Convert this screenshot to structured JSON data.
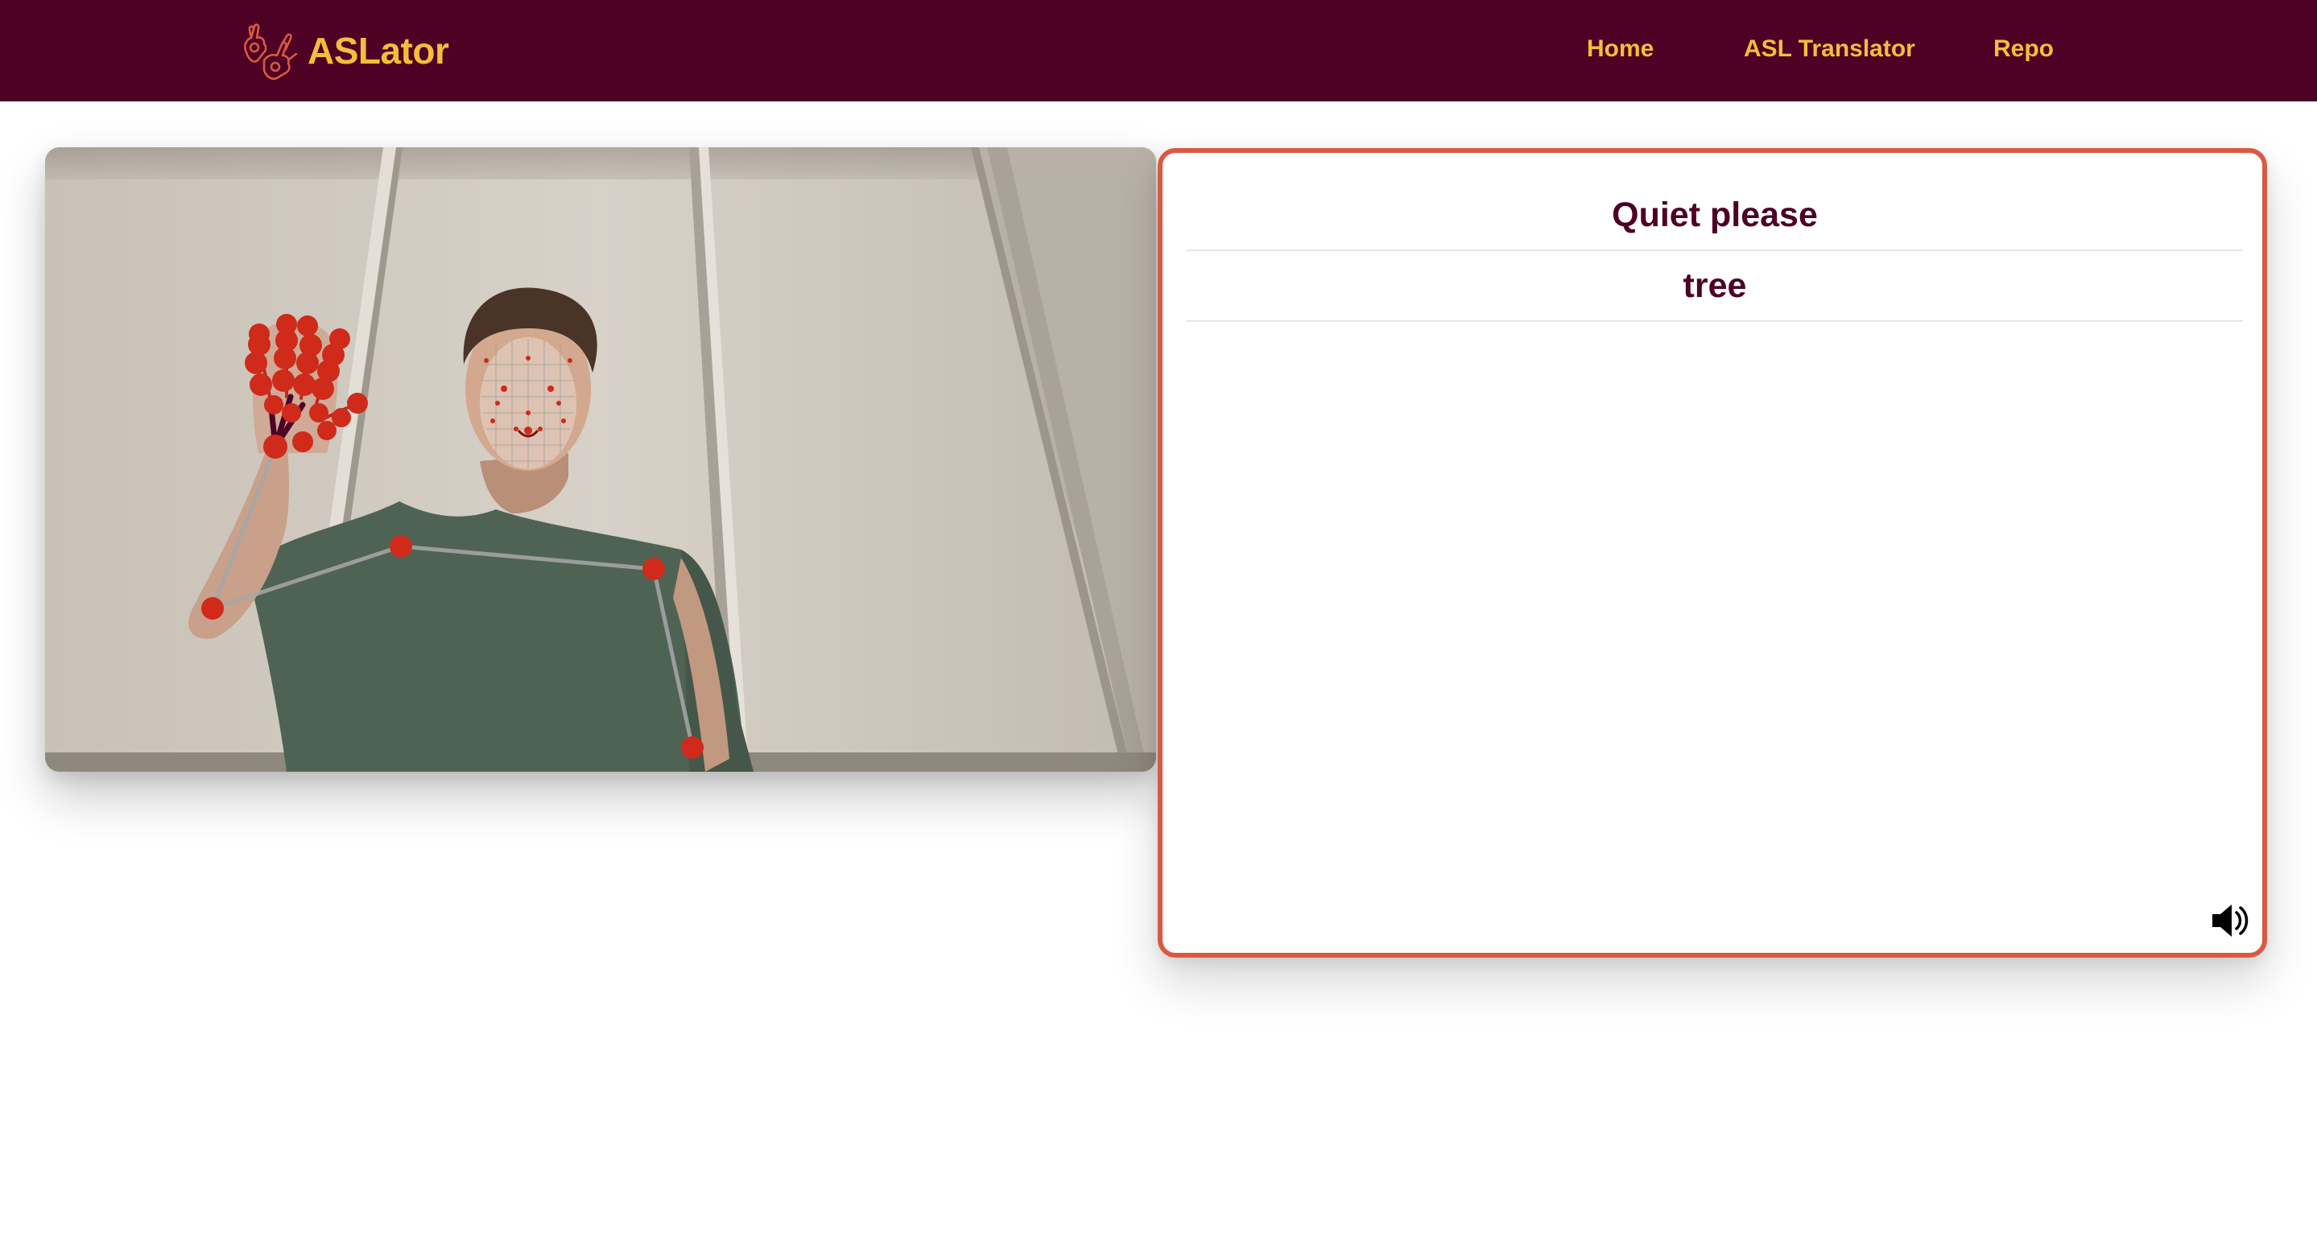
{
  "navbar": {
    "brand": "ASLator",
    "links": [
      {
        "label": "Home"
      },
      {
        "label": "ASL Translator"
      },
      {
        "label": "Repo"
      }
    ]
  },
  "translations": [
    "Quiet please",
    "tree"
  ],
  "colors": {
    "navbar_bg": "#4e0025",
    "accent_text": "#f6bd3b",
    "panel_border": "#d95a42",
    "landmark": "#cf2a1a",
    "translation_text": "#4e0025"
  },
  "icons": {
    "brand": "asl-hands-logo-icon",
    "speaker": "speaker-volume-icon"
  }
}
